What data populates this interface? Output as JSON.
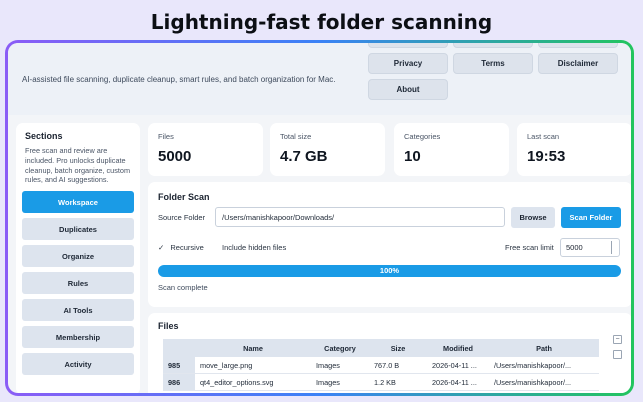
{
  "headline": "Lightning-fast folder scanning",
  "header": {
    "tagline": "AI-assisted file scanning, duplicate cleanup, smart rules, and batch organization for Mac.",
    "buttons": [
      "Privacy",
      "Terms",
      "Disclaimer",
      "About"
    ]
  },
  "sidebar": {
    "title": "Sections",
    "description": "Free scan and review are included. Pro unlocks duplicate cleanup, batch organize, custom rules, and AI suggestions.",
    "items": [
      "Workspace",
      "Duplicates",
      "Organize",
      "Rules",
      "AI Tools",
      "Membership",
      "Activity"
    ],
    "active_index": 0
  },
  "stats": [
    {
      "label": "Files",
      "value": "5000"
    },
    {
      "label": "Total size",
      "value": "4.7 GB"
    },
    {
      "label": "Categories",
      "value": "10"
    },
    {
      "label": "Last scan",
      "value": "19:53"
    }
  ],
  "scan": {
    "title": "Folder Scan",
    "source_label": "Source Folder",
    "source_value": "/Users/manishkapoor/Downloads/",
    "browse_label": "Browse",
    "scan_label": "Scan Folder",
    "recursive_check": "✓",
    "recursive_label": "Recursive",
    "hidden_label": "Include hidden files",
    "limit_label": "Free scan limit",
    "limit_value": "5000",
    "progress_text": "100%",
    "progress_fraction": 1.0,
    "status": "Scan complete"
  },
  "files": {
    "title": "Files",
    "columns": [
      "",
      "Name",
      "Category",
      "Size",
      "Modified",
      "Path"
    ],
    "rows": [
      [
        "985",
        "move_large.png",
        "Images",
        "767.0 B",
        "2026-04-11 ...",
        "/Users/manishkapoor/..."
      ],
      [
        "986",
        "qt4_editor_options.svg",
        "Images",
        "1.2 KB",
        "2026-04-11 ...",
        "/Users/manishkapoor/..."
      ]
    ],
    "collapse_glyph": "−"
  },
  "colors": {
    "accent": "#1a9be6",
    "frame_start": "#8b5cf6",
    "frame_end": "#22c55e"
  }
}
